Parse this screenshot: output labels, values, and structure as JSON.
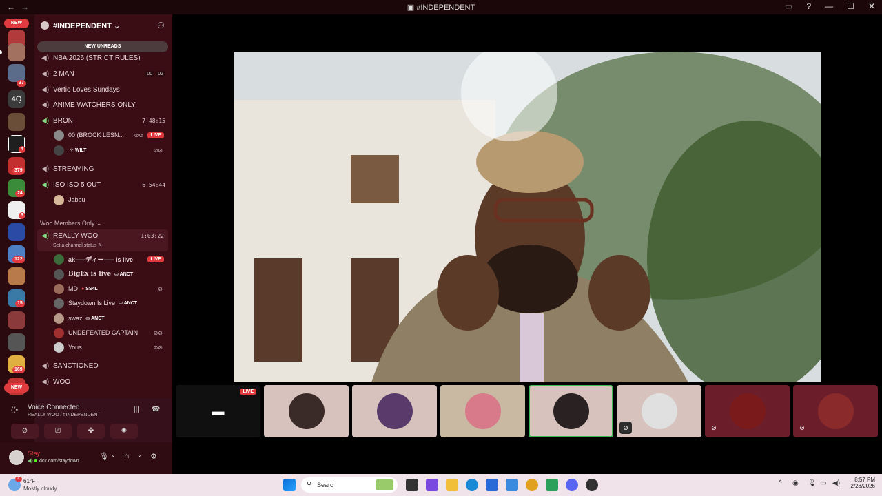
{
  "window": {
    "title": "#INDEPENDENT",
    "back_icon": "←",
    "forward_icon": "→"
  },
  "rail": {
    "new_label_top": "NEW",
    "new_label_bottom": "NEW",
    "badges": [
      "37",
      "4",
      "379",
      "24",
      "3",
      "122",
      "15",
      "169"
    ],
    "text_server": "4Q"
  },
  "guild": {
    "name": "#INDEPENDENT",
    "new_unreads": "NEW UNREADS"
  },
  "channels": [
    {
      "name": "NBA 2026 (STRICT RULES)"
    },
    {
      "name": "2 MAN",
      "counts": [
        "00",
        "02"
      ]
    },
    {
      "name": "Vertio Loves Sundays"
    },
    {
      "name": "ANIME WATCHERS ONLY"
    },
    {
      "name": "BRON",
      "timer": "7:48:15"
    },
    {
      "name": "STREAMING"
    },
    {
      "name": "ISO ISO 5 OUT",
      "timer": "6:54:44"
    }
  ],
  "bron_users": [
    {
      "name": "00 (BROCK LESN...",
      "live": "LIVE"
    },
    {
      "name": "WILT",
      "prefix": "✧"
    }
  ],
  "iso_users": [
    {
      "name": "Jabbu"
    }
  ],
  "category": "Woo Members Only",
  "really_woo": {
    "name": "REALLY WOO",
    "timer": "1:03:22",
    "status": "Set a channel status"
  },
  "woo_users": [
    {
      "name": "ak⸺ディー⸺ is live",
      "live": "LIVE"
    },
    {
      "name": "BigEx is live",
      "tag": "ANCT"
    },
    {
      "name": "MD",
      "tag": "SS4L"
    },
    {
      "name": "Staydown Is Live",
      "tag": "ANCT"
    },
    {
      "name": "swaz",
      "tag": "ANCT"
    },
    {
      "name": "UNDEFEATED CAPTAIN"
    },
    {
      "name": "Yous"
    }
  ],
  "channels_bottom": [
    {
      "name": "SANCTIONED"
    },
    {
      "name": "WOO"
    }
  ],
  "voice": {
    "title": "Voice Connected",
    "sub": "REALLY WOO / #INDEPENDENT"
  },
  "user_panel": {
    "name": "Stay",
    "status": "kick.com/staydown"
  },
  "stage": {
    "live_label": "LIVE"
  },
  "taskbar": {
    "temp": "61°F",
    "condition": "Mostly cloudy",
    "weather_badge": "4",
    "search_label": "Search",
    "time": "8:57 PM",
    "date": "2/28/2026"
  }
}
